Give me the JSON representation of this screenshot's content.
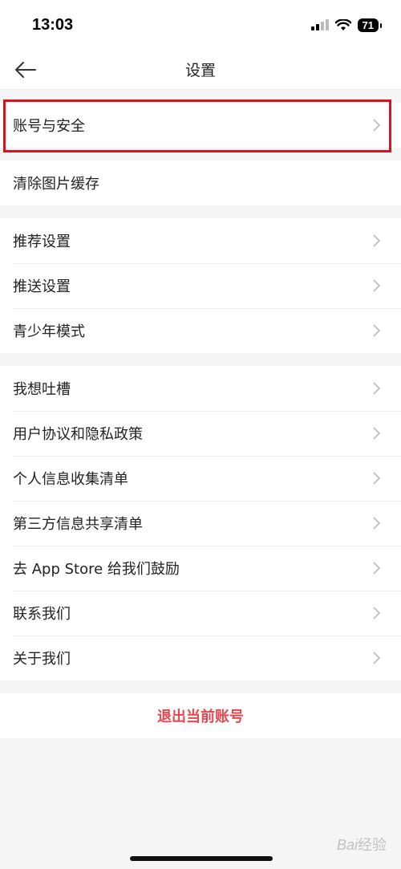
{
  "status_bar": {
    "time": "13:03",
    "battery": "71"
  },
  "nav": {
    "title": "设置"
  },
  "groups": [
    {
      "items": [
        {
          "label": "账号与安全",
          "chevron": true
        }
      ]
    },
    {
      "items": [
        {
          "label": "清除图片缓存",
          "chevron": false
        }
      ]
    },
    {
      "items": [
        {
          "label": "推荐设置",
          "chevron": true
        },
        {
          "label": "推送设置",
          "chevron": true
        },
        {
          "label": "青少年模式",
          "chevron": true
        }
      ]
    },
    {
      "items": [
        {
          "label": "我想吐槽",
          "chevron": true
        },
        {
          "label": "用户协议和隐私政策",
          "chevron": true
        },
        {
          "label": "个人信息收集清单",
          "chevron": true
        },
        {
          "label": "第三方信息共享清单",
          "chevron": true
        },
        {
          "label": "去 App Store 给我们鼓励",
          "chevron": true
        },
        {
          "label": "联系我们",
          "chevron": true
        },
        {
          "label": "关于我们",
          "chevron": true
        }
      ]
    }
  ],
  "logout": {
    "label": "退出当前账号"
  },
  "watermark": {
    "text": "Bai经验"
  },
  "colors": {
    "highlight": "#d9121b",
    "logout": "#e8474f"
  }
}
